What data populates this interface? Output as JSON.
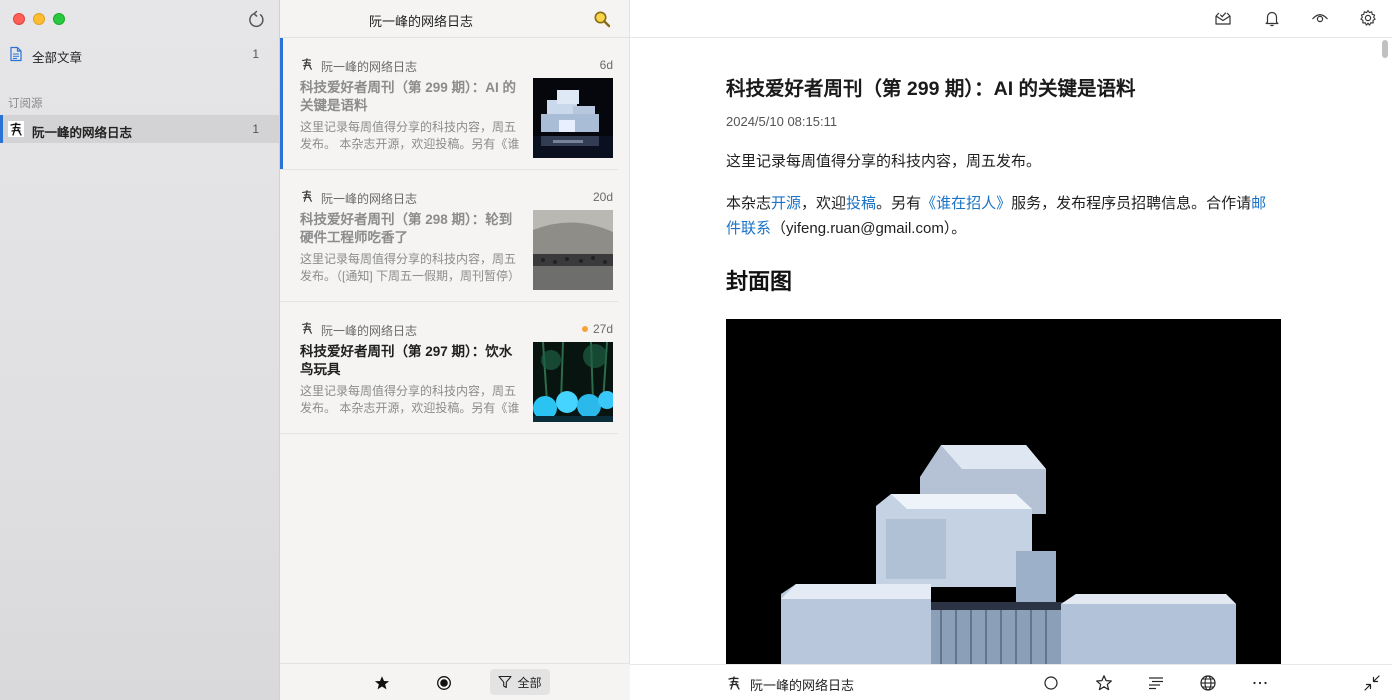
{
  "sidebar": {
    "all_articles": {
      "label": "全部文章",
      "count": "1"
    },
    "section_label": "订阅源",
    "feeds": [
      {
        "label": "阮一峰的网络日志",
        "count": "1"
      }
    ]
  },
  "list": {
    "title": "阮一峰的网络日志",
    "items": [
      {
        "source": "阮一峰的网络日志",
        "age": "6d",
        "unread": false,
        "title": "科技爱好者周刊（第 299 期）：AI 的关键是语料",
        "snippet": "这里记录每周值得分享的科技内容，周五发布。 本杂志开源，欢迎投稿。另有《谁在招人》服务"
      },
      {
        "source": "阮一峰的网络日志",
        "age": "20d",
        "unread": false,
        "title": "科技爱好者周刊（第 298 期）：轮到硬件工程师吃香了",
        "snippet": "这里记录每周值得分享的科技内容，周五发布。（[通知] 下周五一假期，周刊暂停）"
      },
      {
        "source": "阮一峰的网络日志",
        "age": "27d",
        "unread": true,
        "title": "科技爱好者周刊（第 297 期）：饮水鸟玩具",
        "snippet": "这里记录每周值得分享的科技内容，周五发布。 本杂志开源，欢迎投稿。另有《谁在招人》服务"
      }
    ],
    "footer": {
      "filter_label": "全部"
    }
  },
  "reader": {
    "title": "科技爱好者周刊（第 299 期）：AI 的关键是语料",
    "date": "2024/5/10 08:15:11",
    "p1": "这里记录每周值得分享的科技内容，周五发布。",
    "p2": {
      "t1": "本杂志",
      "link1": "开源",
      "t2": "，欢迎",
      "link2": "投稿",
      "t3": "。另有",
      "link3": "《谁在招人》",
      "t4": "服务，发布程序员招聘信息。合作请",
      "link4": "邮件联系",
      "t5": "（yifeng.ruan@gmail.com）。"
    },
    "cover_heading": "封面图",
    "footer_source": "阮一峰的网络日志"
  },
  "colors": {
    "accent": "#2a72d8",
    "link": "#1a73c6",
    "unread_dot": "#f5a23b"
  }
}
